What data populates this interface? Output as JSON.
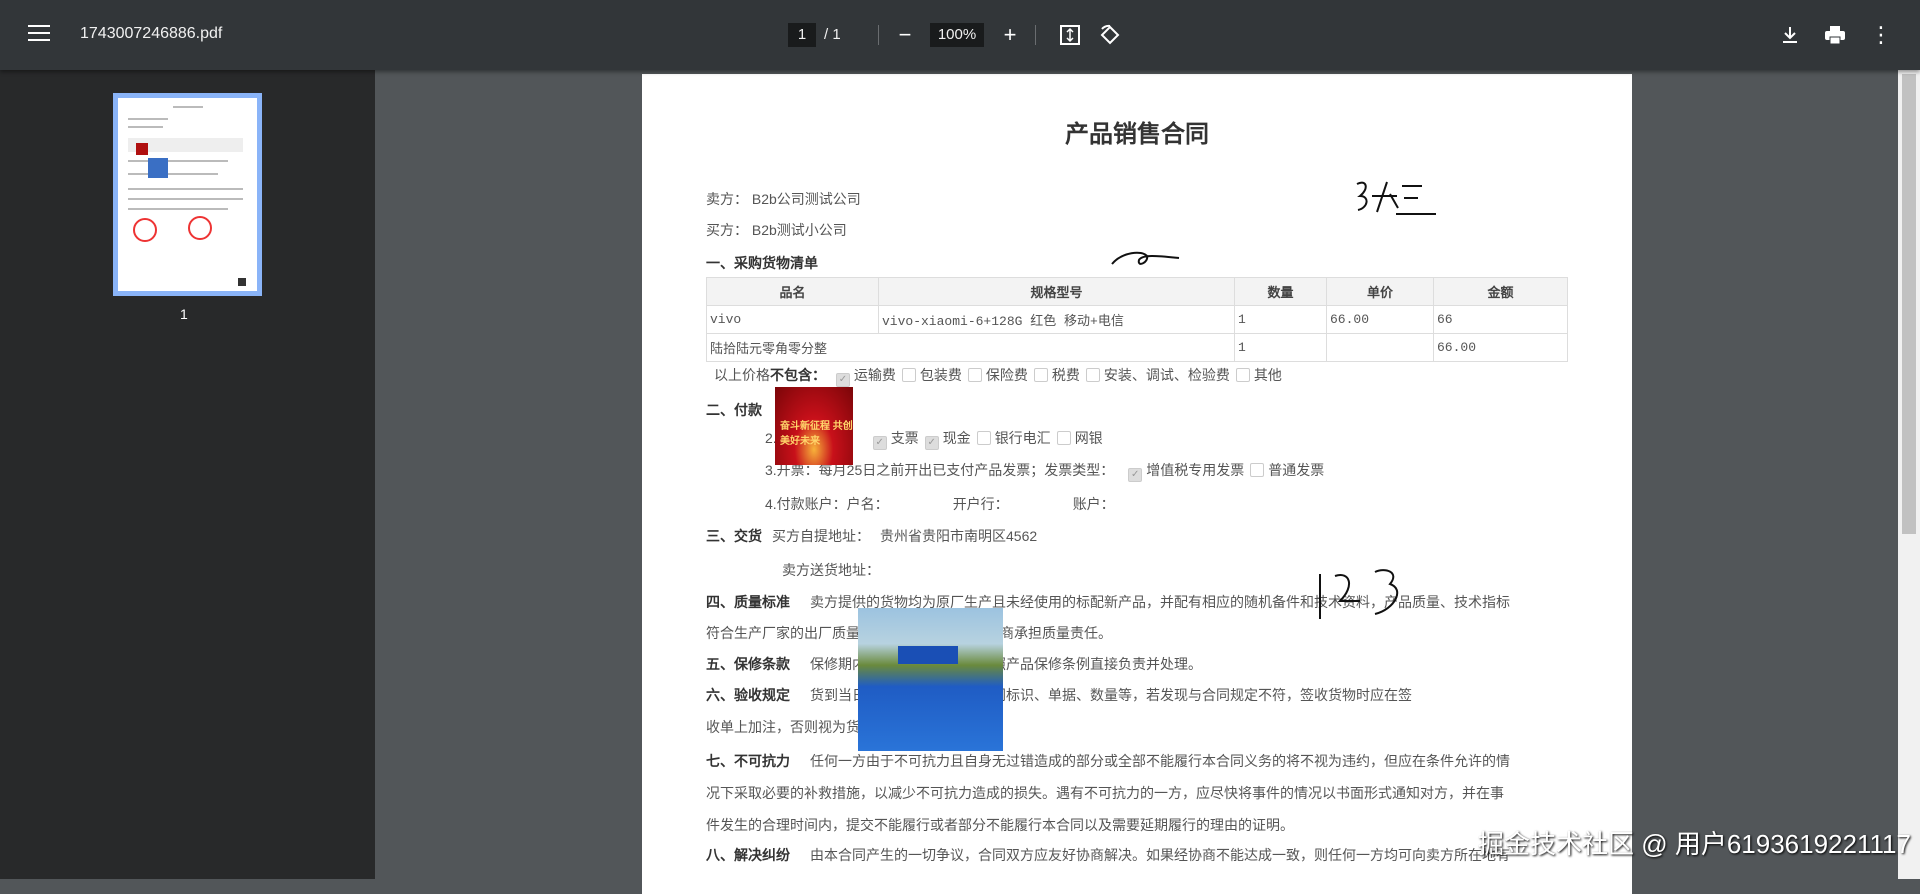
{
  "toolbar": {
    "file_name": "1743007246886.pdf",
    "page_current": "1",
    "page_total": "/ 1",
    "zoom": "100%"
  },
  "sidebar": {
    "thumb_label": "1"
  },
  "doc": {
    "title": "产品销售合同",
    "seller_label": "卖方：",
    "seller": "B2b公司测试公司",
    "buyer_label": "买方：",
    "buyer": "B2b测试小公司",
    "sec1": "一、采购货物清单",
    "table": {
      "headers": [
        "品名",
        "规格型号",
        "数量",
        "单价",
        "金额"
      ],
      "row1": [
        "vivo",
        "vivo-xiaomi-6+128G 红色 移动+电信",
        "1",
        "66.00",
        "66"
      ],
      "row2": [
        "陆拾陆元零角零分整",
        "1",
        "",
        "66.00"
      ]
    },
    "excl_label_a": "以上价格",
    "excl_label_b": "不包含：",
    "excl_options": [
      {
        "label": "运输费",
        "checked": true
      },
      {
        "label": "包装费",
        "checked": false
      },
      {
        "label": "保险费",
        "checked": false
      },
      {
        "label": "税费",
        "checked": false
      },
      {
        "label": "安装、调试、检验费",
        "checked": false
      },
      {
        "label": "其他",
        "checked": false
      }
    ],
    "sec2": "二、付款",
    "pay2_prefix": "2.",
    "pay_methods": [
      {
        "label": "支票",
        "checked": true
      },
      {
        "label": "现金",
        "checked": true
      },
      {
        "label": "银行电汇",
        "checked": false
      },
      {
        "label": "网银",
        "checked": false
      }
    ],
    "pay3": "3.开票：每月25日之前开出已支付产品发票；发票类型：",
    "invoice_types": [
      {
        "label": "增值税专用发票",
        "checked": true
      },
      {
        "label": "普通发票",
        "checked": false
      }
    ],
    "pay4": "4.付款账户：户名：",
    "pay4_bank": "开户行：",
    "pay4_acct": "账户：",
    "sec3": "三、交货",
    "pickup_label": "买方自提地址：",
    "pickup": "贵州省贵阳市南明区4562",
    "delivery_label": "卖方送货地址：",
    "sec4": "四、质量标准",
    "sec4_l1": "卖方提供的货物均为原厂生产且未经使用的标配新产品，并配有相应的随机备件和技术资料，产品质量、技术指标",
    "sec4_l2": "符合生产厂家的出厂质量标准，该产品由生产厂商承担质量责任。",
    "sec5": "五、保修条款",
    "sec5_l1": "保修期内的服务均由原厂商按照产品保修条例直接负责并处理。",
    "sec6": "六、验收规定",
    "sec6_l1": "货到当日买方应检查产品各项同标识、单据、数量等，若发现与合同规定不符，签收货物时应在签",
    "sec6_l2": "收单上加注，否则视为货物符合合同规定。",
    "sec7": "七、不可抗力",
    "sec7_l1": "任何一方由于不可抗力且自身无过错造成的部分或全部不能履行本合同义务的将不视为违约，但应在条件允许的情",
    "sec7_l2": "况下采取必要的补救措施，以减少不可抗力造成的损失。遇有不可抗力的一方，应尽快将事件的情况以书面形式通知对方，并在事",
    "sec7_l3": "件发生的合理时间内，提交不能履行或者部分不能履行本合同以及需要延期履行的理由的证明。",
    "sec8": "八、解决纠纷",
    "sec8_l1": "由本合同产生的一切争议，合同双方应友好协商解决。如果经协商不能达成一致，则任何一方均可向卖方所在地有",
    "signature_text": "张三",
    "handwriting_numbers": "123",
    "banner_image_text": "奋斗新征程 共创美好未来"
  },
  "watermark": "掘金技术社区 @ 用户6193619221117"
}
